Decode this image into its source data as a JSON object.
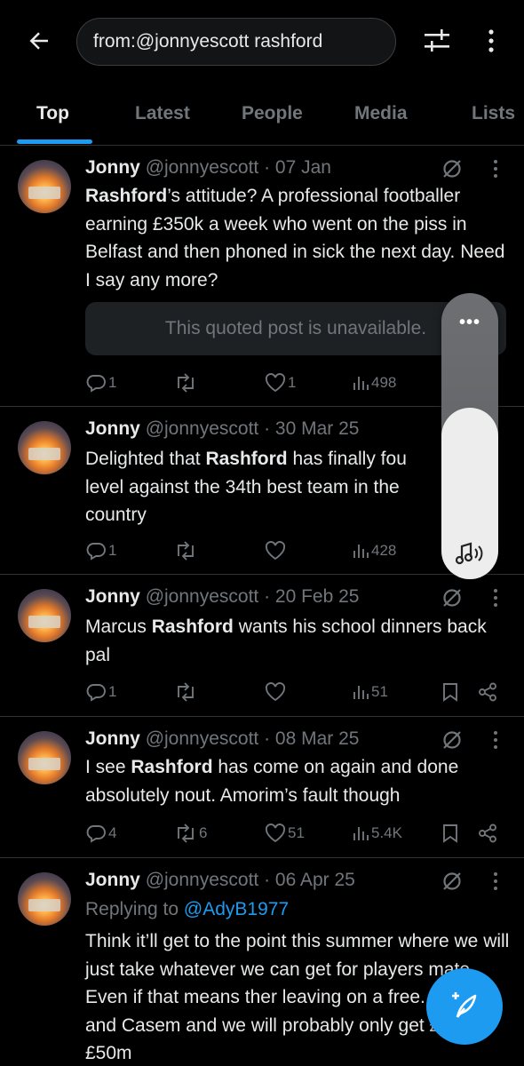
{
  "header": {
    "search_value": "from:@jonnyescott rashford"
  },
  "tabs": [
    {
      "label": "Top",
      "active": true
    },
    {
      "label": "Latest"
    },
    {
      "label": "People"
    },
    {
      "label": "Media"
    },
    {
      "label": "Lists"
    }
  ],
  "posts": [
    {
      "name": "Jonny",
      "meta": "@jonnyescott · 07 Jan",
      "text_parts": [
        {
          "b": true,
          "t": "Rashford"
        },
        {
          "t": "’s attitude? A professional footballer earning £350k a week who went on the piss in Belfast and then phoned in sick the next day. Need I say any more?"
        }
      ],
      "quoted": "This quoted post is unavailable.",
      "replies": "1",
      "reposts": "",
      "likes": "1",
      "views": "498"
    },
    {
      "name": "Jonny",
      "meta": "@jonnyescott · 30 Mar 25",
      "text_parts": [
        {
          "t": "Delighted that "
        },
        {
          "b": true,
          "t": "Rashford"
        },
        {
          "t": " has finally fou"
        }
      ],
      "text_line2": "level against the 34th best team in the",
      "text_line3": "country",
      "replies": "1",
      "reposts": "",
      "likes": "",
      "views": "428"
    },
    {
      "name": "Jonny",
      "meta": "@jonnyescott · 20 Feb 25",
      "text_parts": [
        {
          "t": "Marcus "
        },
        {
          "b": true,
          "t": "Rashford"
        },
        {
          "t": " wants his school dinners back pal"
        }
      ],
      "replies": "1",
      "reposts": "",
      "likes": "",
      "views": "51"
    },
    {
      "name": "Jonny",
      "meta": "@jonnyescott · 08 Mar 25",
      "text_parts": [
        {
          "t": "I see "
        },
        {
          "b": true,
          "t": "Rashford"
        },
        {
          "t": " has come on again and done absolutely nout. Amorim’s fault though"
        }
      ],
      "replies": "4",
      "reposts": "6",
      "likes": "51",
      "views": "5.4K"
    },
    {
      "name": "Jonny",
      "meta": "@jonnyescott · 06 Apr 25",
      "reply_label": "Replying to ",
      "reply_handle": "@AdyB1977",
      "text": "Think it’ll get to the point this summer where we will just take whatever we can get for players mate. Even if that means ther leaving on a free. Sancho and Casem and we will probably only get £40m/£50m"
    }
  ],
  "overlay": {
    "dots": "•••",
    "level": 0.6
  },
  "colors": {
    "accent": "#1d9bf0",
    "muted": "#71767b",
    "text": "#e7e9ea",
    "border": "#2f3336"
  }
}
